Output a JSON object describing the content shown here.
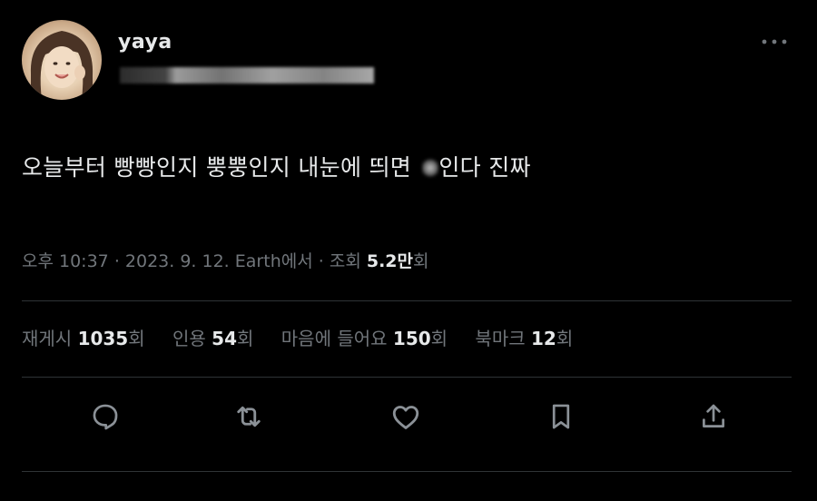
{
  "user": {
    "display_name": "yaya",
    "avatar_icon": "profile-photo"
  },
  "tweet": {
    "text_before": "오늘부터 빵빵인지 뿡뿡인지 내눈에 띄면",
    "text_after": "인다 진짜"
  },
  "meta": {
    "time": "오후 10:37",
    "date": "2023. 9. 12.",
    "source": "Earth에서",
    "views_label": "조회",
    "views_value": "5.2만",
    "views_unit": "회",
    "separator": "·"
  },
  "stats": [
    {
      "label": "재게시",
      "value": "1035",
      "unit": "회"
    },
    {
      "label": "인용",
      "value": "54",
      "unit": "회"
    },
    {
      "label": "마음에 들어요",
      "value": "150",
      "unit": "회"
    },
    {
      "label": "북마크",
      "value": "12",
      "unit": "회"
    }
  ],
  "actions": [
    {
      "name": "reply-icon"
    },
    {
      "name": "retweet-icon"
    },
    {
      "name": "like-icon"
    },
    {
      "name": "bookmark-icon"
    },
    {
      "name": "share-icon"
    }
  ],
  "colors": {
    "background": "#000000",
    "text_primary": "#e7e9ea",
    "text_secondary": "#71767b",
    "divider": "#2f3336"
  }
}
